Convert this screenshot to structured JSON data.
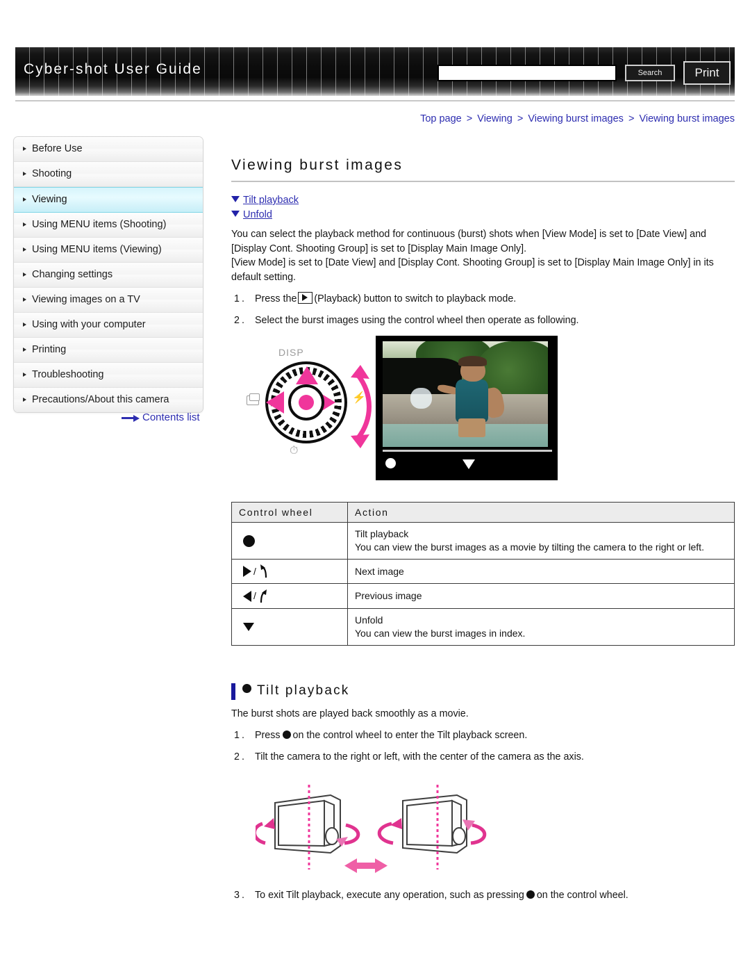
{
  "header": {
    "site_title": "Cyber-shot User Guide",
    "search_placeholder": "",
    "search_value": "",
    "search_button": "Search",
    "print_button": "Print"
  },
  "breadcrumb": {
    "items": [
      "Top page",
      "Viewing",
      "Viewing burst images",
      "Viewing burst images"
    ],
    "separator": ">"
  },
  "sidebar": {
    "items": [
      {
        "label": "Before Use",
        "active": false
      },
      {
        "label": "Shooting",
        "active": false
      },
      {
        "label": "Viewing",
        "active": true
      },
      {
        "label": "Using MENU items (Shooting)",
        "active": false
      },
      {
        "label": "Using MENU items (Viewing)",
        "active": false
      },
      {
        "label": "Changing settings",
        "active": false
      },
      {
        "label": "Viewing images on a TV",
        "active": false
      },
      {
        "label": "Using with your computer",
        "active": false
      },
      {
        "label": "Printing",
        "active": false
      },
      {
        "label": "Troubleshooting",
        "active": false
      },
      {
        "label": "Precautions/About this camera",
        "active": false
      }
    ],
    "contents_list_label": "Contents list"
  },
  "main": {
    "page_title": "Viewing burst images",
    "anchor_links": [
      {
        "label": "Tilt playback"
      },
      {
        "label": "Unfold"
      }
    ],
    "intro_paragraph_1": "You can select the playback method for continuous (burst) shots when [View Mode] is set to [Date View] and [Display Cont. Shooting Group] is set to [Display Main Image Only].",
    "intro_paragraph_2": "[View Mode] is set to [Date View] and [Display Cont. Shooting Group] is set to [Display Main Image Only] in its default setting.",
    "steps": [
      {
        "num": "1.",
        "text_before": "Press the",
        "icon": "playback-icon",
        "text_after": "(Playback) button to switch to playback mode."
      },
      {
        "num": "2.",
        "text_before": "Select the burst images using the control wheel then operate as following.",
        "icon": "",
        "text_after": ""
      }
    ],
    "wheel_figure": {
      "disp_label": "DISP",
      "flash_label": "⚡",
      "timer_label": "⏱",
      "lcd_dot": "●",
      "lcd_triangle": "▼"
    },
    "table": {
      "headers": [
        "Control wheel",
        "Action"
      ],
      "rows": [
        {
          "key_icon": "center-dot",
          "lines": [
            "Tilt playback",
            "You can view the burst images as a movie by tilting the camera to the right or left."
          ]
        },
        {
          "key_icon": "right-rotate",
          "lines": [
            "Next image"
          ]
        },
        {
          "key_icon": "left-rotate",
          "lines": [
            "Previous image"
          ]
        },
        {
          "key_icon": "down-triangle",
          "lines": [
            "Unfold",
            "You can view the burst images in index."
          ]
        }
      ]
    },
    "tilt_section": {
      "heading": "Tilt playback",
      "paragraph": "The burst shots are played back smoothly as a movie.",
      "steps": [
        {
          "num": "1.",
          "text_before": "Press",
          "icon": "dot-icon",
          "text_after": "on the control wheel to enter the Tilt playback screen."
        },
        {
          "num": "2.",
          "text_before": "Tilt the camera to the right or left, with the center of the camera as the axis.",
          "icon": "",
          "text_after": ""
        },
        {
          "num": "3.",
          "text_before": "To exit Tilt playback, execute any operation, such as pressing",
          "icon": "dot-icon",
          "text_after": "on the control wheel."
        }
      ]
    }
  },
  "colors": {
    "link": "#2d2db0",
    "accent_pink": "#f0369b",
    "active_sidebar": "#d4f3fa",
    "heading_bar": "#19199c",
    "banner_dark": "#0a0a0a"
  }
}
